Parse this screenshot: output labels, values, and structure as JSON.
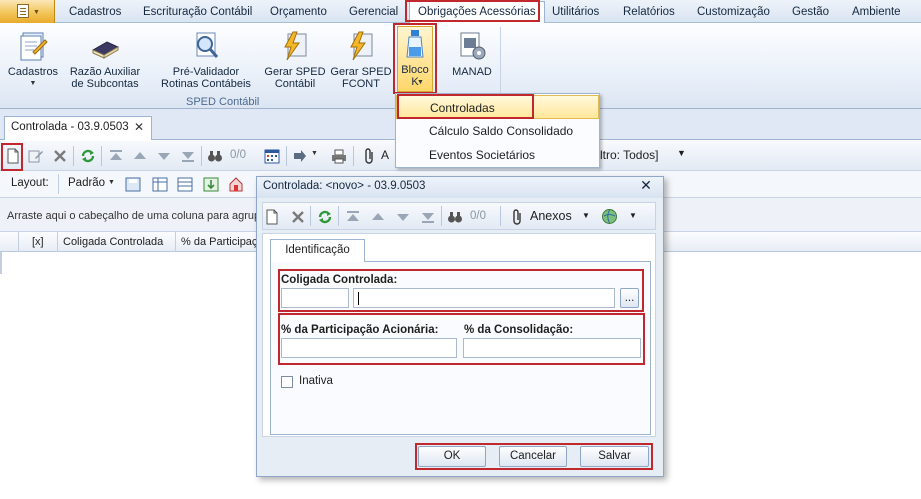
{
  "ribbon_tabs": [
    "Cadastros",
    "Escrituração Contábil",
    "Orçamento",
    "Gerencial",
    "Obrigações Acessórias",
    "Utilitários",
    "Relatórios",
    "Customização",
    "Gestão",
    "Ambiente"
  ],
  "ribbon": {
    "buttons": [
      {
        "line1": "Cadastros",
        "line2": ""
      },
      {
        "line1": "Razão Auxiliar",
        "line2": "de Subcontas"
      },
      {
        "line1": "Pré-Validador",
        "line2": "Rotinas Contábeis"
      },
      {
        "line1": "Gerar SPED",
        "line2": "Contábil"
      },
      {
        "line1": "Gerar SPED",
        "line2": "FCONT"
      },
      {
        "line1": "Bloco",
        "line2": "K"
      },
      {
        "line1": "MANAD",
        "line2": ""
      }
    ],
    "group_label": "SPED Contábil"
  },
  "menu": {
    "items": [
      "Controladas",
      "Cálculo Saldo Consolidado",
      "Eventos Societários"
    ]
  },
  "document_tab": {
    "label": "Controlada - 03.9.0503"
  },
  "toolbar": {
    "counter": "0/0",
    "anexos_partial": "A",
    "filter_text": "ltro: Todos]"
  },
  "layout_bar": {
    "label": "Layout:",
    "value": "Padrão"
  },
  "group_hint": "Arraste aqui o cabeçalho de uma coluna para agrupa",
  "grid": {
    "columns": [
      "[x]",
      "Coligada Controlada",
      "% da Participaçã"
    ]
  },
  "dialog": {
    "title": "Controlada: <novo> - 03.9.0503",
    "counter": "0/0",
    "anexos": "Anexos",
    "tab": "Identificação",
    "field_coligada": "Coligada Controlada:",
    "field_participacao": "% da Participação Acionária:",
    "field_consolidacao": "% da Consolidação:",
    "checkbox_label": "Inativa",
    "lookup_button": "...",
    "ok": "OK",
    "cancel": "Cancelar",
    "save": "Salvar"
  }
}
